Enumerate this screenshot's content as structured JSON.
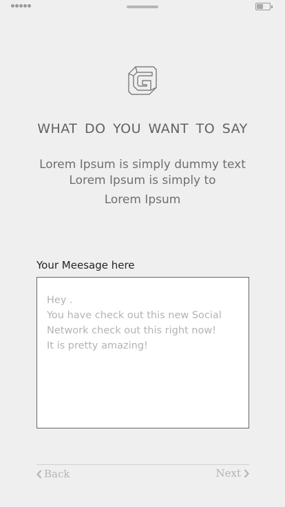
{
  "status_bar": {
    "signal_icon": "signal-dots-icon",
    "battery_icon": "battery-icon"
  },
  "logo": {
    "icon": "g-logo-icon"
  },
  "heading": "WHAT DO YOU WANT TO SAY",
  "intro": {
    "line1": "Lorem Ipsum is simply dummy text",
    "line2": "Lorem Ipsum is simply to",
    "line3": "Lorem Ipsum"
  },
  "message": {
    "label": "Your Meesage here",
    "lines": [
      "Hey .",
      "You have check out this new Social",
      "Network check out this right now!",
      "It is pretty amazing!"
    ]
  },
  "navigation": {
    "back_label": "Back",
    "next_label": "Next"
  },
  "colors": {
    "background": "#efefef",
    "heading": "#616161",
    "muted": "#b5b5b5"
  }
}
